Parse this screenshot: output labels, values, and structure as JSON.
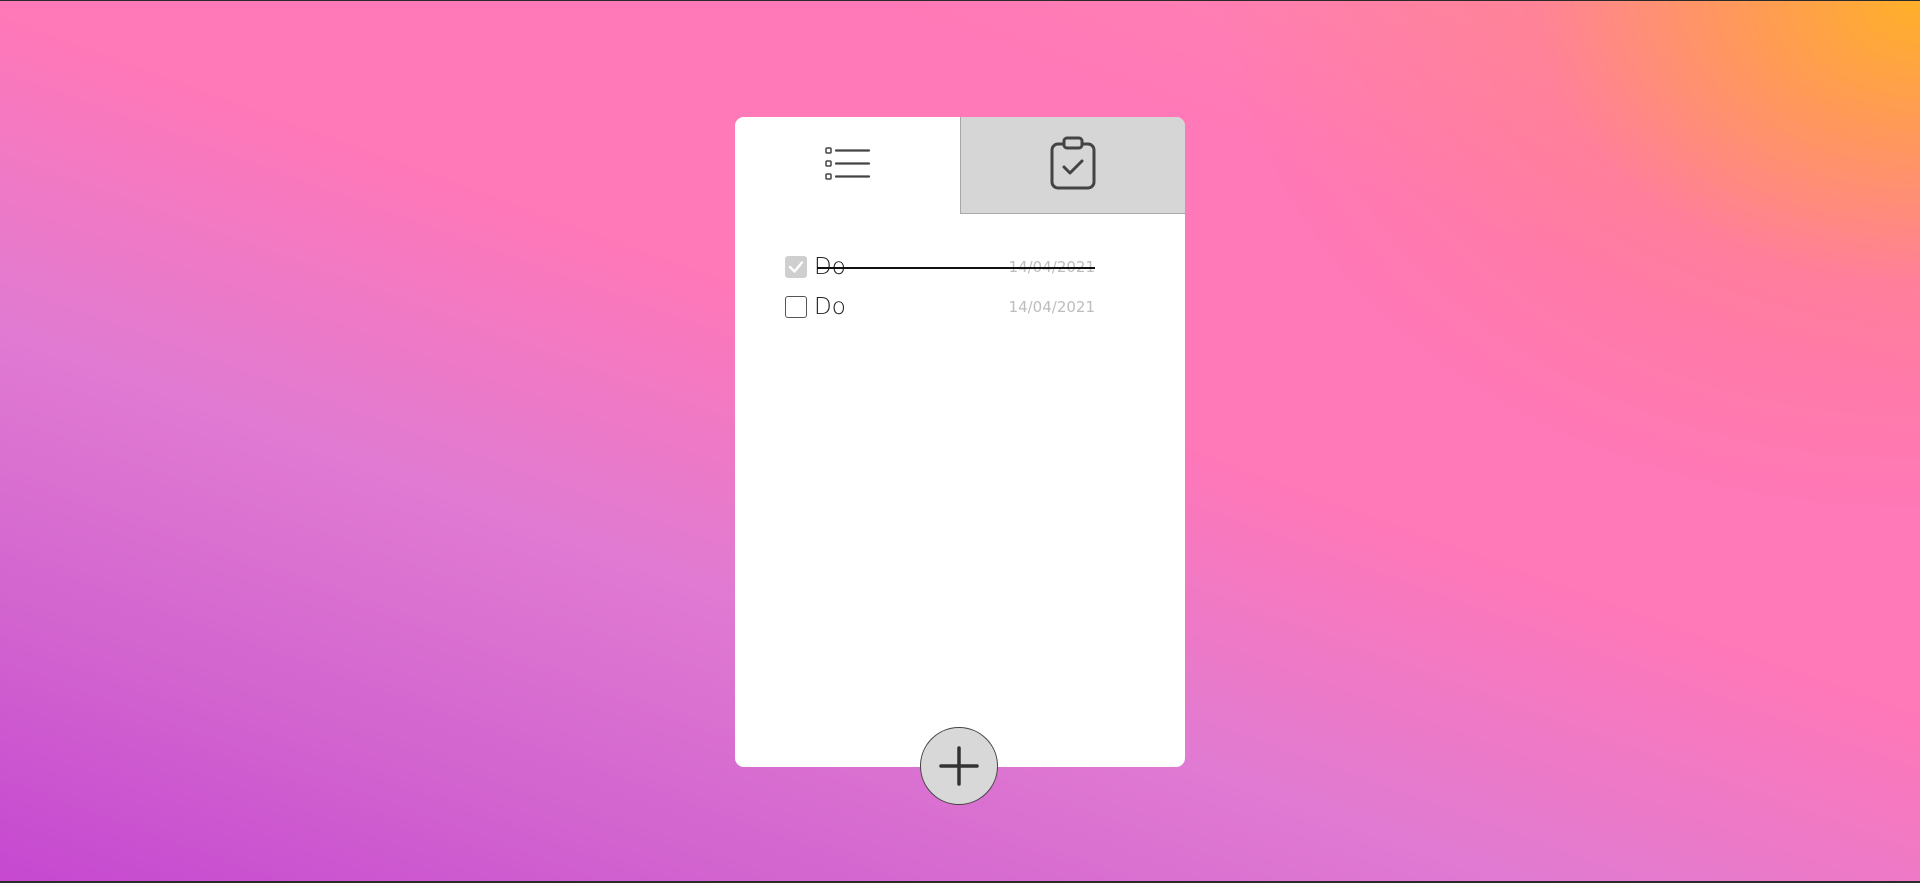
{
  "tabs": [
    {
      "name": "todo-list",
      "icon": "list-icon",
      "active": true
    },
    {
      "name": "completed",
      "icon": "clipboard-check-icon",
      "active": false
    }
  ],
  "todos": [
    {
      "text": "Do",
      "date": "14/04/2021",
      "done": true
    },
    {
      "text": "Do",
      "date": "14/04/2021",
      "done": false
    }
  ],
  "add_button": {
    "icon": "plus-icon"
  },
  "colors": {
    "card": "#ffffff",
    "inactive_tab": "#d6d6d6",
    "add_button": "#d8d8d8",
    "date_text": "#bdbdbd"
  }
}
